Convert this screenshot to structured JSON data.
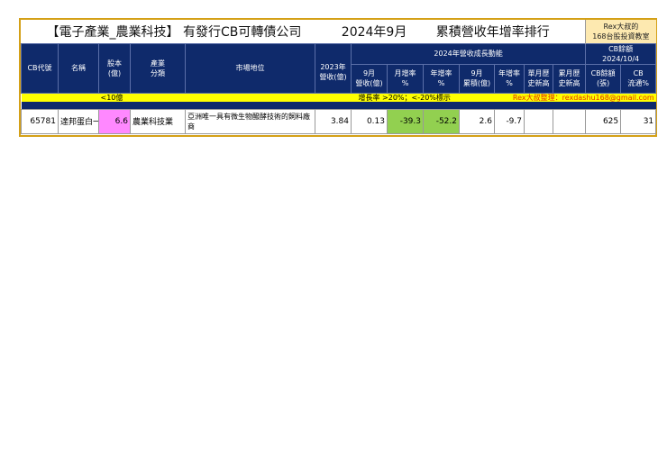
{
  "title": {
    "main": "【電子產業_農業科技】 有發行CB可轉債公司",
    "period": "2024年9月",
    "subject": "累積營收年增率排行",
    "rex_line1": "Rex大叔的",
    "rex_line2": "168台股投資教室"
  },
  "headers": {
    "code": "CB代號",
    "name": "名稱",
    "capital": "股本\n(億)",
    "industry": "產業\n分類",
    "market": "市場地位",
    "rev2023": "2023年\n營收(億)",
    "group": "2024年營收成長動能",
    "sep_rev": "9月\n營收(億)",
    "mom": "月增率\n%",
    "yoy": "年增率\n%",
    "cum": "9月\n累積(億)",
    "cum_yoy": "年增率\n%",
    "single_high": "單月歷\n史新高",
    "cum_high": "累月歷\n史新高",
    "cb_group": "CB餘額\n2024/10/4",
    "cb_balance": "CB餘額\n(張)",
    "cb_float": "CB\n流通%"
  },
  "legend": {
    "capital_bucket": "<10億",
    "rule": "增長率 >20%；<-20%標示",
    "credit": "Rex大叔整理：rexdashu168@gmail.com"
  },
  "rows": [
    {
      "code": "65781",
      "name": "達邦蛋白一",
      "capital": "6.6",
      "industry": "農業科技業",
      "market": "亞洲唯一具有微生物醱酵技術的飼料廠商",
      "rev2023": "3.84",
      "sep_rev": "0.13",
      "mom": "-39.3",
      "yoy": "-52.2",
      "cum": "2.6",
      "cum_yoy": "-9.7",
      "single_high": "",
      "cum_high": "",
      "cb_balance": "625",
      "cb_float": "31"
    }
  ],
  "colors": {
    "navy": "#0f2a6b",
    "yellow": "#ffff00",
    "pink": "#ff88ff",
    "green": "#92d050",
    "gold": "#d4a017"
  }
}
